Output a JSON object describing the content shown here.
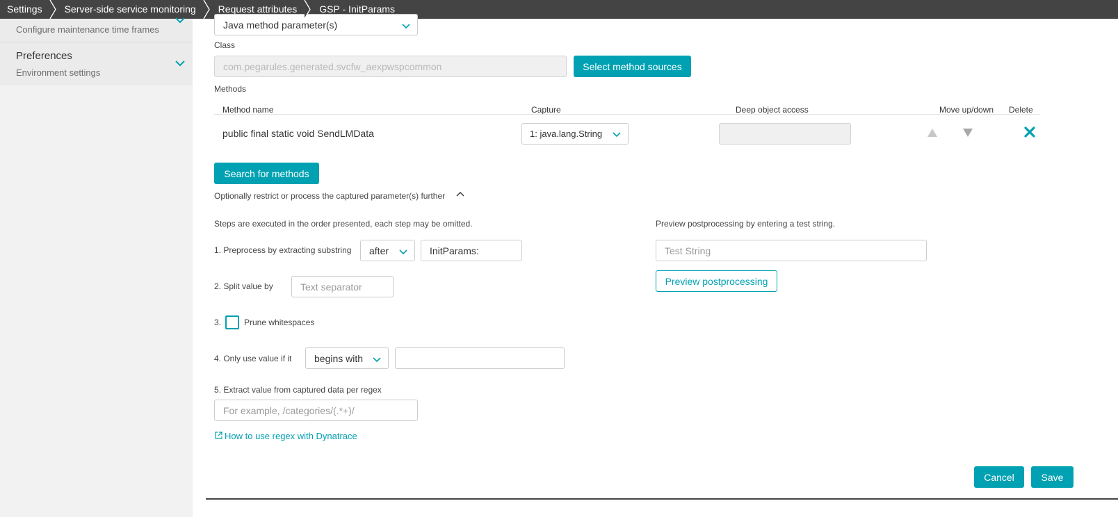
{
  "breadcrumb": [
    "Settings",
    "Server-side service monitoring",
    "Request attributes",
    "GSP - InitParams"
  ],
  "sidebar": {
    "items": [
      {
        "subtitle": "Configure maintenance time frames"
      },
      {
        "title": "Preferences",
        "subtitle": "Environment settings"
      }
    ]
  },
  "source": {
    "selected": "Java method parameter(s)"
  },
  "class": {
    "label": "Class",
    "value": "com.pegarules.generated.svcfw_aexpwspcommon",
    "select_sources_label": "Select method sources"
  },
  "methods": {
    "label": "Methods",
    "columns": {
      "name": "Method name",
      "capture": "Capture",
      "deep": "Deep object access",
      "move": "Move up/down",
      "delete": "Delete"
    },
    "rows": [
      {
        "name": "public final static void SendLMData",
        "capture": "1: java.lang.String",
        "deep": ""
      }
    ],
    "search_label": "Search for methods"
  },
  "postprocess": {
    "toggle_label": "Optionally restrict or process the captured parameter(s) further",
    "intro": "Steps are executed in the order presented, each step may be omitted.",
    "step1": {
      "label": "1. Preprocess by extracting substring",
      "mode": "after",
      "value": "InitParams:"
    },
    "step2": {
      "label": "2. Split value by",
      "placeholder": "Text separator"
    },
    "step3": {
      "label": "3.",
      "checkbox_label": "Prune whitespaces",
      "checked": false
    },
    "step4": {
      "label": "4. Only use value if it",
      "mode": "begins with",
      "value": ""
    },
    "step5": {
      "label": "5. Extract value from captured data per regex",
      "placeholder": "For example, /categories/(.*+)/"
    },
    "regex_help_link": "How to use regex with Dynatrace",
    "preview": {
      "label": "Preview postprocessing by entering a test string.",
      "placeholder": "Test String",
      "button_label": "Preview postprocessing"
    }
  },
  "footer": {
    "cancel_label": "Cancel",
    "save_label": "Save"
  },
  "colors": {
    "accent": "#00a1b2",
    "topbar": "#444444",
    "sidebar": "#f2f2f2"
  }
}
